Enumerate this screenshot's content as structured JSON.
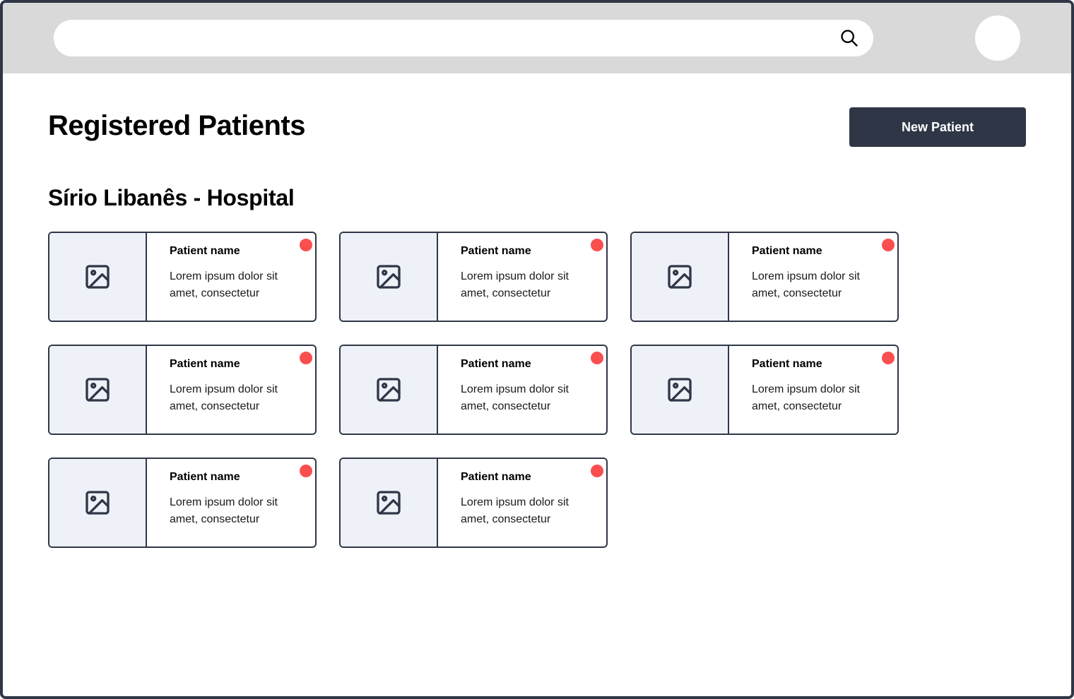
{
  "search": {
    "value": "",
    "placeholder": ""
  },
  "header": {
    "title": "Registered Patients",
    "new_button_label": "New Patient"
  },
  "section": {
    "title": "Sírio Libanês - Hospital"
  },
  "colors": {
    "primary": "#2f3747",
    "status_dot": "#fa4f4f",
    "thumb_bg": "#eef1f8",
    "topbar_bg": "#d9d9d9"
  },
  "icons": {
    "search": "search-icon",
    "thumbnail": "image-placeholder-icon"
  },
  "patients": [
    {
      "name": "Patient name",
      "description": "Lorem ipsum dolor sit amet, consectetur"
    },
    {
      "name": "Patient name",
      "description": "Lorem ipsum dolor sit amet, consectetur"
    },
    {
      "name": "Patient name",
      "description": "Lorem ipsum dolor sit amet, consectetur"
    },
    {
      "name": "Patient name",
      "description": "Lorem ipsum dolor sit amet, consectetur"
    },
    {
      "name": "Patient name",
      "description": "Lorem ipsum dolor sit amet, consectetur"
    },
    {
      "name": "Patient name",
      "description": "Lorem ipsum dolor sit amet, consectetur"
    },
    {
      "name": "Patient name",
      "description": "Lorem ipsum dolor sit amet, consectetur"
    },
    {
      "name": "Patient name",
      "description": "Lorem ipsum dolor sit amet, consectetur"
    }
  ]
}
